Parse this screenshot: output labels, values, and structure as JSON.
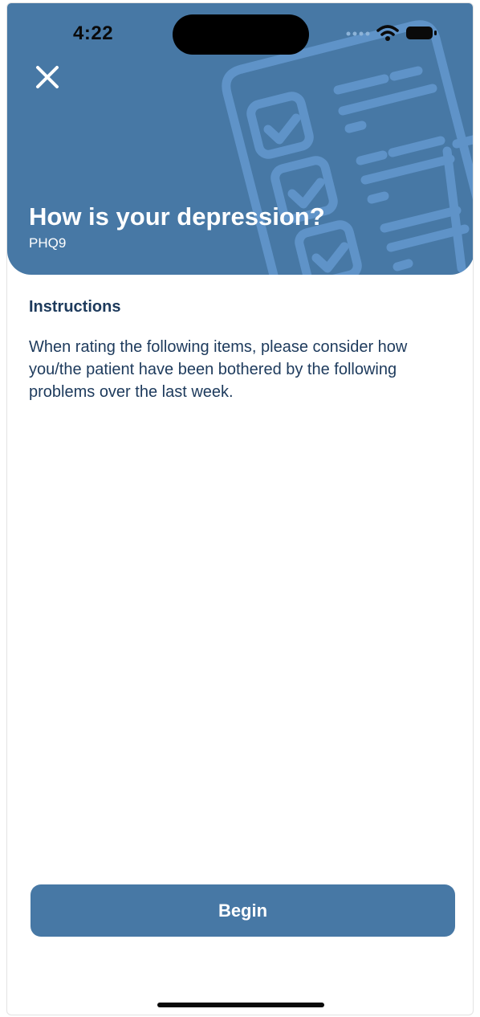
{
  "status_bar": {
    "time": "4:22",
    "icons": [
      "signal-icon",
      "wifi-icon",
      "battery-icon"
    ]
  },
  "header": {
    "close_icon": "close-icon",
    "title": "How is your depression?",
    "subtitle": "PHQ9",
    "background_illustration": "checklist-clipboard-icon"
  },
  "instructions": {
    "heading": "Instructions",
    "text": "When rating the following items, please consider how you/the patient have been bothered by the following problems over the last week."
  },
  "actions": {
    "begin_label": "Begin"
  },
  "colors": {
    "accent": "#4778a5",
    "text_dark": "#1d3a5c",
    "illustration": "#5f93c8"
  }
}
